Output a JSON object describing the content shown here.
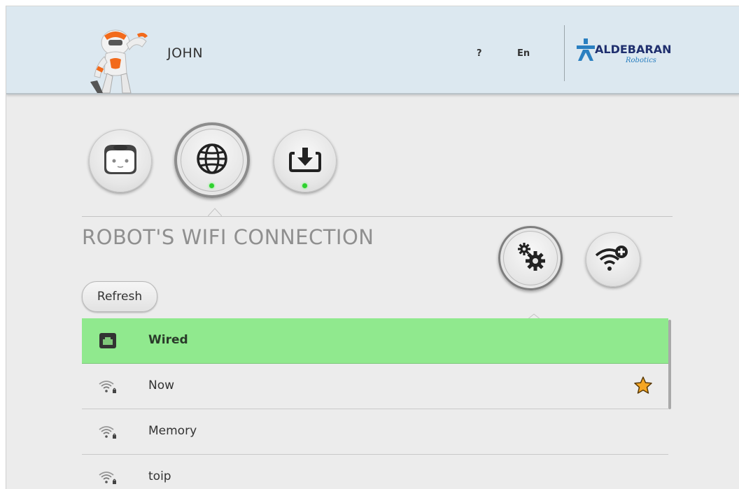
{
  "header": {
    "user_name": "JOHN",
    "help_label": "?",
    "language_label": "En",
    "brand": {
      "name": "ALDEBARAN",
      "sub": "Robotics"
    },
    "avatar_icon": "nao-robot-icon"
  },
  "top_nav": [
    {
      "icon": "robot-face-icon",
      "active": false,
      "status": false
    },
    {
      "icon": "globe-icon",
      "active": true,
      "status": true
    },
    {
      "icon": "download-icon",
      "active": false,
      "status": true
    }
  ],
  "section": {
    "title": "ROBOT'S WIFI CONNECTION",
    "refresh_label": "Refresh"
  },
  "actions": [
    {
      "icon": "gears-icon",
      "active": true
    },
    {
      "icon": "wifi-add-icon",
      "active": false
    }
  ],
  "networks": [
    {
      "name": "Wired",
      "type": "wired",
      "active": true,
      "favorite": false
    },
    {
      "name": "Now",
      "type": "wifi-secured",
      "active": false,
      "favorite": true
    },
    {
      "name": "Memory",
      "type": "wifi-secured",
      "active": false,
      "favorite": false
    },
    {
      "name": "toip",
      "type": "wifi-secured",
      "active": false,
      "favorite": false
    }
  ],
  "colors": {
    "header_bg": "#dce8f0",
    "active_row": "#90e98e",
    "status_dot": "#2fd12f",
    "favorite_star": "#f5a623",
    "brand": "#1f2f6e"
  }
}
